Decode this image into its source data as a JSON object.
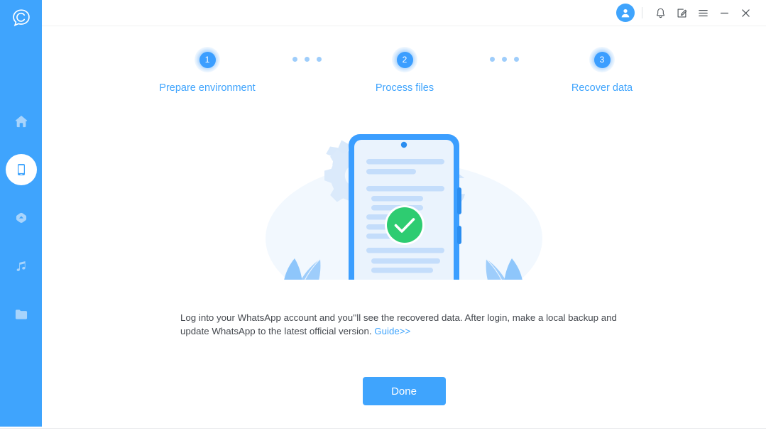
{
  "window": {
    "brand_logo_icon": "chat-bubble-c-logo",
    "titlebar": {
      "avatar_icon": "user-avatar-icon",
      "buttons": [
        {
          "icon": "bell-icon",
          "name": "notifications-button"
        },
        {
          "icon": "feedback-icon",
          "name": "feedback-button"
        },
        {
          "icon": "hamburger-icon",
          "name": "menu-button"
        },
        {
          "icon": "minimize-icon",
          "name": "minimize-button"
        },
        {
          "icon": "close-icon",
          "name": "close-button"
        }
      ]
    }
  },
  "sidebar": {
    "background": "#3fa4fd",
    "items": [
      {
        "icon": "home-icon",
        "name": "sidebar-item-home",
        "active": false
      },
      {
        "icon": "phone-icon",
        "name": "sidebar-item-phone",
        "active": true
      },
      {
        "icon": "transfer-icon",
        "name": "sidebar-item-transfer",
        "active": false
      },
      {
        "icon": "music-icon",
        "name": "sidebar-item-music",
        "active": false
      },
      {
        "icon": "folder-icon",
        "name": "sidebar-item-folder",
        "active": false
      }
    ]
  },
  "stepper": {
    "active_color": "#3fa4fd",
    "dot_color": "#9ecdfb",
    "steps": [
      {
        "number": "1",
        "label": "Prepare environment"
      },
      {
        "number": "2",
        "label": "Process files"
      },
      {
        "number": "3",
        "label": "Recover data"
      }
    ]
  },
  "illustration": {
    "name": "phone-recovery-success-illustration",
    "status_icon": "green-check-circle-icon",
    "accent_color": "#3b9eff",
    "success_color": "#2ecc71"
  },
  "description": {
    "text": "Log into your WhatsApp account and you''ll see the recovered data. After login, make a local backup and update WhatsApp to the latest official version. ",
    "link_label": "Guide>>"
  },
  "actions": {
    "done_label": "Done"
  }
}
